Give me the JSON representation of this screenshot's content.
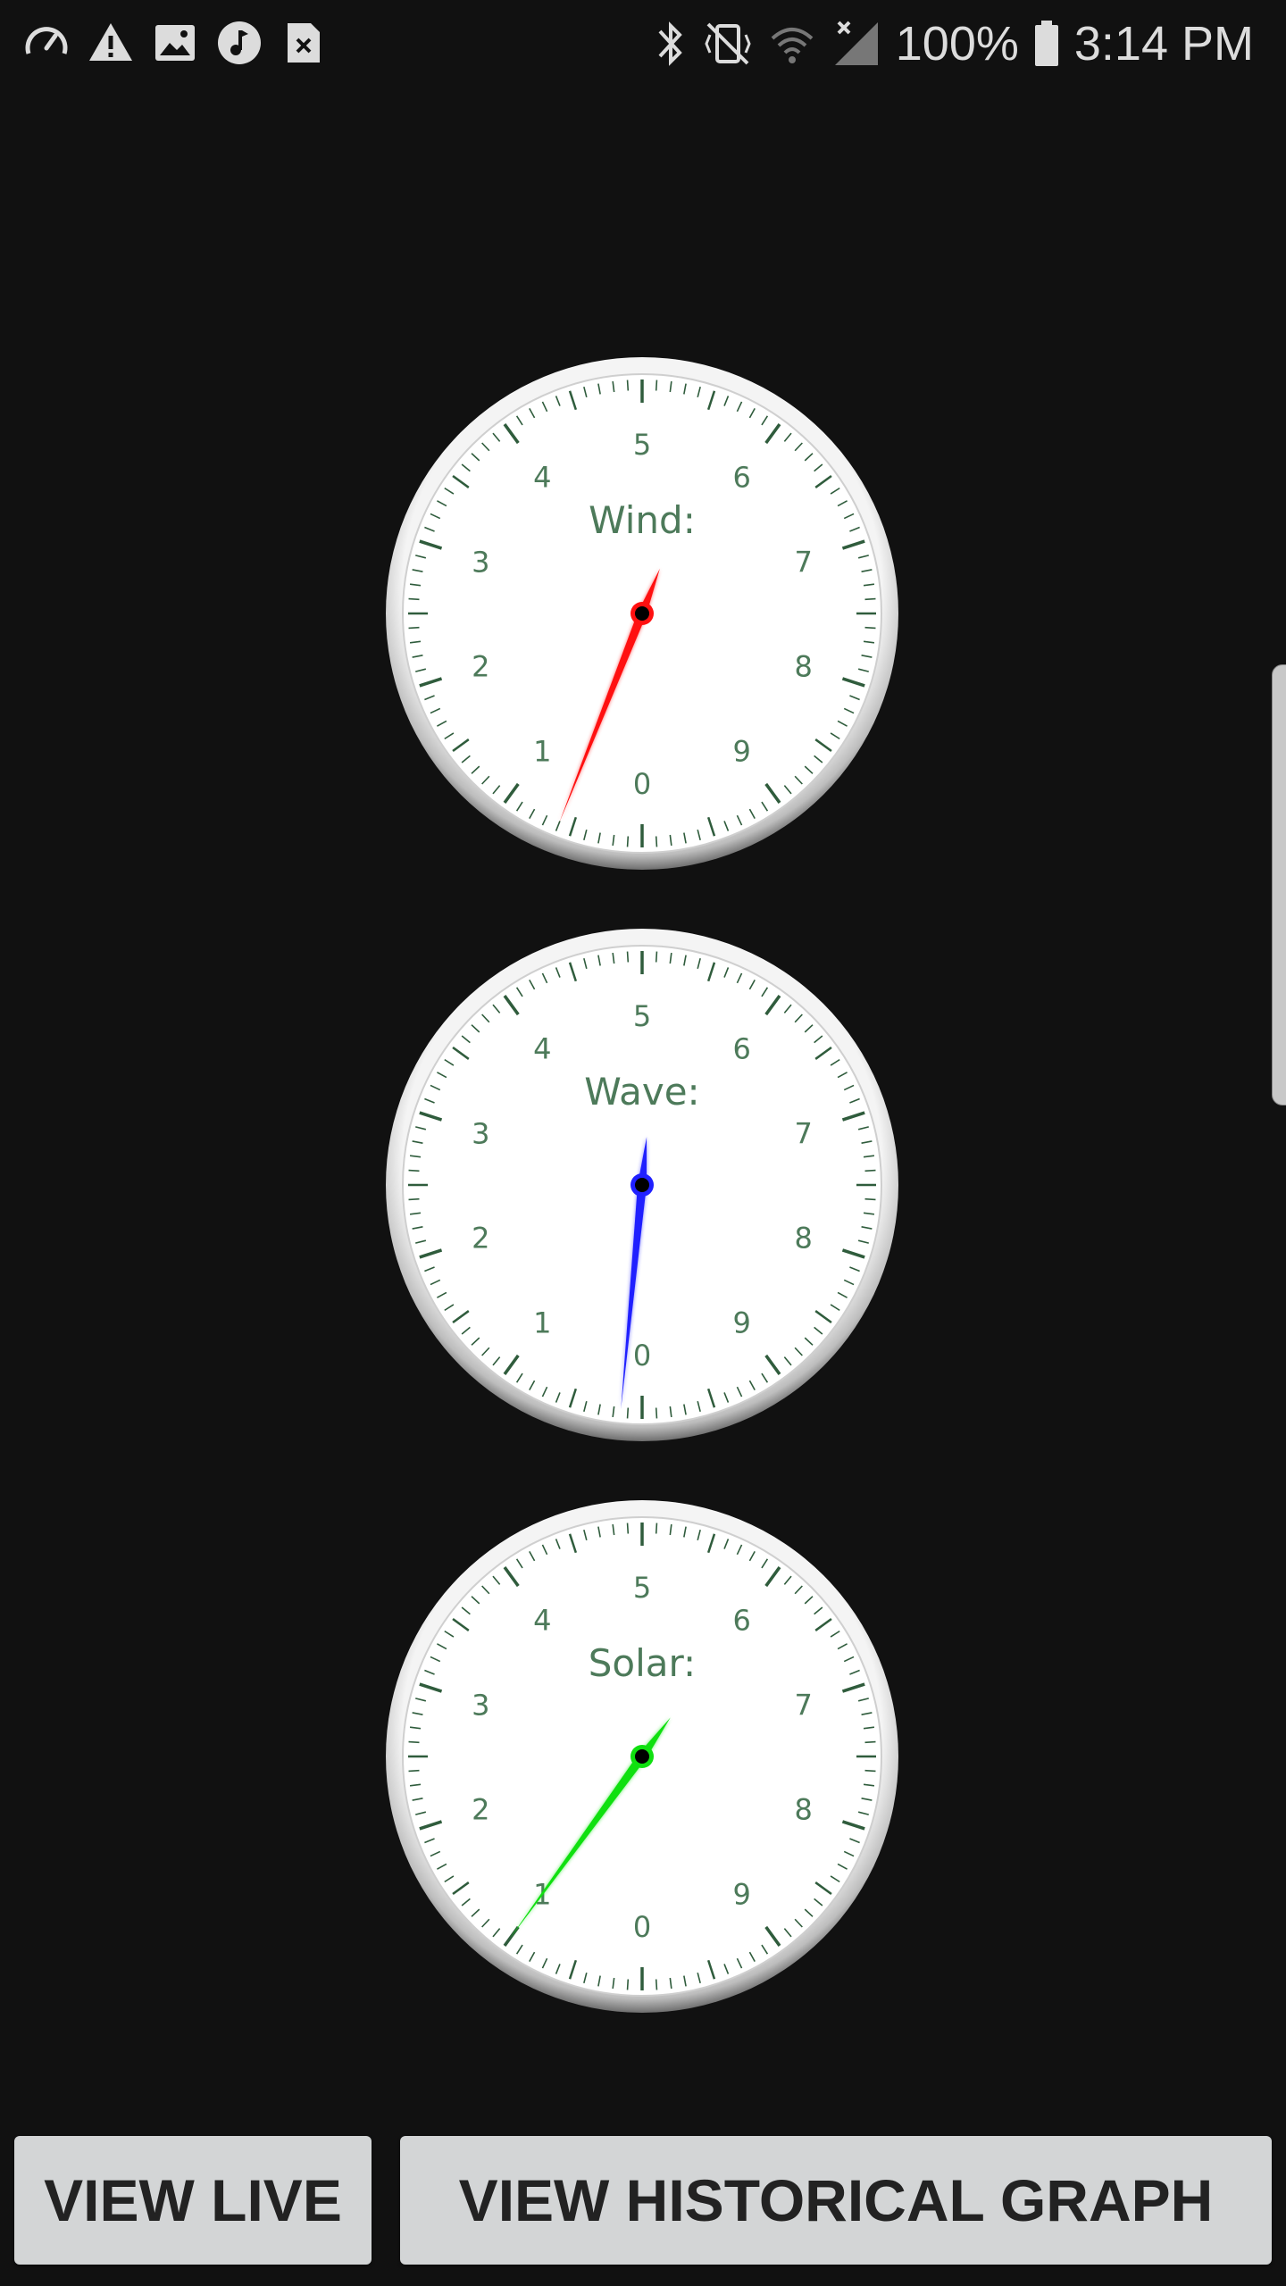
{
  "status_bar": {
    "battery": "100%",
    "time": "3:14 PM",
    "left_icons": [
      "speedometer-icon",
      "warning-icon",
      "image-icon",
      "music-icon",
      "file-error-icon"
    ],
    "right_icons": [
      "bluetooth-icon",
      "vibrate-mute-icon",
      "wifi-icon",
      "cell-signal-icon",
      "battery-icon"
    ]
  },
  "gauges": [
    {
      "label": "Wind:",
      "value": 0.6,
      "needle_color": "#ff1010"
    },
    {
      "label": "Wave:",
      "value": 0.15,
      "needle_color": "#2020ff"
    },
    {
      "label": "Solar:",
      "value": 1.0,
      "needle_color": "#10e010"
    }
  ],
  "dial_numbers": [
    "0",
    "1",
    "2",
    "3",
    "4",
    "5",
    "6",
    "7",
    "8",
    "9"
  ],
  "colors": {
    "dial_text": "#4d7a5a",
    "tick": "#2f5c3c",
    "background": "#111111",
    "button_bg": "#d3d5d6"
  },
  "buttons": {
    "view_live": "VIEW LIVE",
    "view_historical": "VIEW HISTORICAL GRAPH"
  }
}
